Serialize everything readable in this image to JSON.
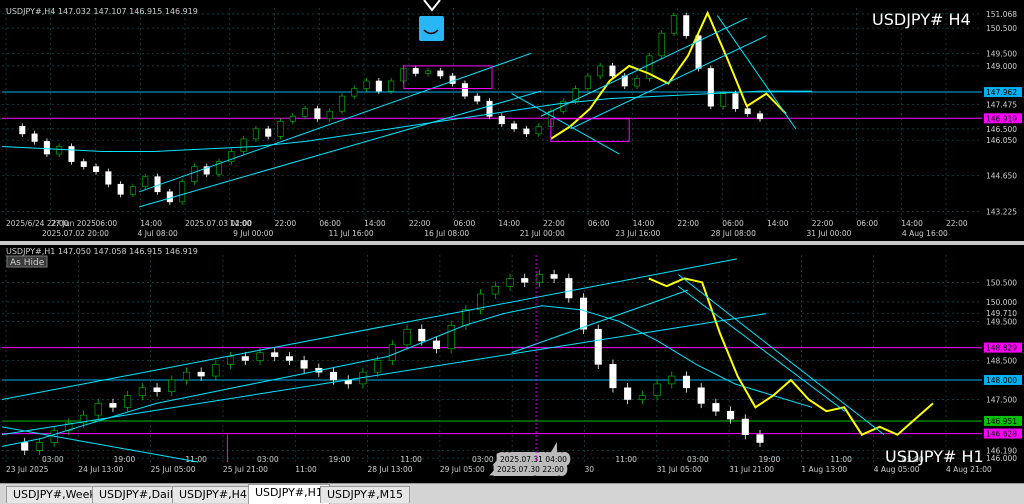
{
  "tabs": [
    "USDJPY#,Weekly",
    "USDJPY#,Daily",
    "USDJPY#,H4",
    "USDJPY#,H1",
    "USDJPY#,M15"
  ],
  "active_tab": 3,
  "chart_data": [
    {
      "type": "line",
      "title": "USDJPY# H4",
      "header": "USDJPY#,H4  147.032 147.107 146.915 146.919",
      "ylim": [
        142.8,
        151.3
      ],
      "price_labels": [
        "151.068",
        "150.500",
        "149.500",
        "149.000",
        "147.962",
        "147.475",
        "146.919",
        "146.500",
        "146.050",
        "144.650",
        "143.225"
      ],
      "highlight_prices": {
        "147.962": "#00b0f0",
        "146.919": "#ff00ff"
      },
      "x_labels": [
        "2025/6/24 22:00",
        "27 Jun 2025",
        "06:00",
        "14:00",
        "2025.07.03 02:00",
        "14:00",
        "22:00",
        "06:00",
        "14:00",
        "22:00",
        "06:00",
        "14:00",
        "22:00",
        "06:00",
        "14:00",
        "22:00",
        "06:00",
        "14:00",
        "22:00",
        "06:00",
        "14:00",
        "22:00"
      ],
      "x_labels_2": [
        "2025.07.02 20:00",
        "4 Jul 08:00",
        "9 Jul 00:00",
        "11 Jul 16:00",
        "16 Jul 08:00",
        "21 Jul 00:00",
        "23 Jul 16:00",
        "28 Jul 08:00",
        "31 Jul 00:00",
        "4 Aug 16:00"
      ],
      "price_path": [
        146.6,
        146.3,
        146.0,
        145.5,
        145.8,
        145.2,
        145.0,
        144.8,
        144.3,
        143.9,
        144.2,
        144.6,
        144.0,
        143.6,
        144.4,
        145.0,
        144.7,
        145.2,
        145.6,
        146.1,
        146.5,
        146.2,
        146.8,
        147.0,
        147.3,
        146.9,
        147.2,
        147.8,
        148.1,
        148.4,
        148.0,
        148.4,
        148.9,
        148.7,
        148.8,
        148.6,
        148.3,
        147.8,
        147.6,
        147.0,
        146.7,
        146.5,
        146.3,
        146.6,
        147.2,
        147.6,
        148.1,
        148.6,
        149.0,
        148.6,
        148.2,
        148.5,
        149.4,
        150.3,
        151.0,
        150.2,
        148.9,
        147.4,
        147.9,
        147.3,
        147.1,
        146.9
      ],
      "zigzag": [
        146.1,
        146.6,
        147.3,
        148.4,
        149.0,
        148.7,
        148.3,
        149.4,
        151.1,
        149.3,
        147.4,
        147.9,
        147.1
      ],
      "ma": [
        145.8,
        145.7,
        145.6,
        145.6,
        145.7,
        145.8,
        146.0,
        146.3,
        146.6,
        146.9,
        147.2,
        147.5,
        147.7,
        147.8,
        147.9,
        148.0,
        148.0
      ]
    },
    {
      "type": "line",
      "title": "USDJPY# H1",
      "header": "USDJPY#,H1  147.050 147.058 146.915 146.919",
      "ylim": [
        145.9,
        151.2
      ],
      "price_labels": [
        "150.500",
        "150.000",
        "149.710",
        "149.500",
        "148.829",
        "148.500",
        "148.000",
        "147.500",
        "146.951",
        "146.628",
        "146.190",
        "146.000"
      ],
      "highlight_prices": {
        "148.829": "#ff00ff",
        "148.000": "#00b0f0",
        "146.951": "#00c000",
        "146.628": "#ff00ff"
      },
      "x_labels": [
        "23 Jul 2025",
        "24 Jul 13:00",
        "25 Jul 05:00",
        "25 Jul 21:00",
        "11:00",
        "28 Jul 13:00",
        "29 Jul 05:00",
        "29 Jul 21:00",
        "30",
        "31 Jul 05:00",
        "31 Jul 21:00",
        "1 Aug 13:00",
        "4 Aug 05:00",
        "4 Aug 21:00"
      ],
      "x_labels_2": [
        "03:00",
        "19:00",
        "11:00",
        "03:00",
        "19:00",
        "11:00",
        "03:00",
        "19:00",
        "11:00",
        "03:00",
        "19:00",
        "11:00",
        "03:00"
      ],
      "x_marker": "2025.07.31 04:00",
      "x_marker_2": "2025.07.30 22:00",
      "button_label": "As Hide",
      "price_path": [
        146.4,
        146.2,
        146.4,
        146.7,
        146.9,
        147.1,
        147.4,
        147.3,
        147.6,
        147.8,
        147.7,
        148.0,
        148.2,
        148.1,
        148.4,
        148.6,
        148.5,
        148.7,
        148.6,
        148.5,
        148.3,
        148.2,
        148.0,
        147.9,
        148.2,
        148.5,
        148.9,
        149.3,
        149.0,
        148.8,
        149.4,
        149.8,
        150.2,
        150.4,
        150.6,
        150.5,
        150.7,
        150.6,
        150.1,
        149.3,
        148.4,
        147.8,
        147.5,
        147.6,
        147.9,
        148.1,
        147.8,
        147.4,
        147.2,
        147.0,
        146.6,
        146.4
      ],
      "zigzag": [
        150.6,
        150.4,
        150.6,
        150.5,
        149.2,
        148.1,
        147.3,
        147.6,
        148.0,
        147.5,
        147.2,
        147.3,
        146.6,
        146.8,
        146.6,
        147.0,
        147.4
      ],
      "ma": [
        146.3,
        146.5,
        146.8,
        147.1,
        147.4,
        147.6,
        147.8,
        148.0,
        148.2,
        148.4,
        148.6,
        149.0,
        149.4,
        149.7,
        149.9,
        149.8,
        149.5,
        149.0,
        148.4,
        147.9,
        147.6,
        147.3
      ]
    }
  ],
  "colors": {
    "bg": "#000000",
    "candle_up": "#00c000",
    "candle_down": "#ffffff",
    "trend": "#00e5ff",
    "zigzag": "#ffff00",
    "ma_green": "#20d020",
    "frame": "#ff00ff",
    "grid": "#1a5050"
  }
}
